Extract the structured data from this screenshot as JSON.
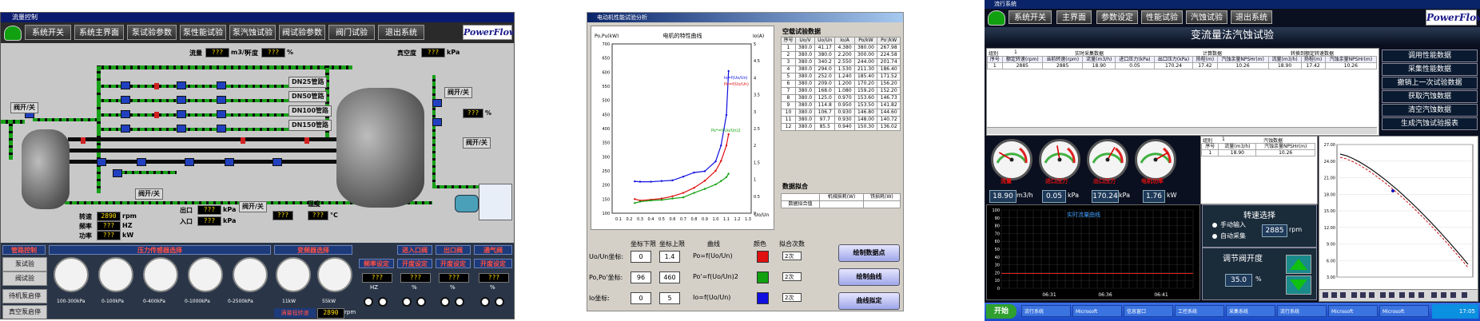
{
  "p1": {
    "window_title": "流量控制",
    "menu": [
      "系统开关",
      "系统主界面",
      "泵试验参数",
      "泵性能试验",
      "泵汽蚀试验",
      "阀试验参数",
      "阀门试验",
      "退出系统"
    ],
    "brand": "PowerFlow",
    "flow_label": "流量",
    "flow_value": "???",
    "flow_unit": "m3/h",
    "opening_label": "开度",
    "opening_value": "???",
    "opening_unit": "%",
    "vacuum_label": "真空度",
    "vacuum_value": "???",
    "vacuum_unit": "kPa",
    "dn_labels": [
      "DN25管路",
      "DN50管路",
      "DN100管路",
      "DN150管路"
    ],
    "valve_switch": "阀开/关",
    "opening_small": "开度",
    "opening_small_value": "???",
    "opening_small_unit": "%",
    "speed_label": "转速",
    "speed_value": "2890",
    "speed_unit": "rpm",
    "freq_label": "频率",
    "freq_value": "???",
    "freq_unit": "HZ",
    "power_label": "功率",
    "power_value": "???",
    "power_unit": "kW",
    "outlet_label": "出口",
    "outlet_value": "???",
    "outlet_unit": "kPa",
    "inlet_label": "入口",
    "inlet_value": "???",
    "inlet_unit": "kPa",
    "temp_label": "温度",
    "temp_value": "???",
    "temp_unit": "°C",
    "controls": {
      "mgmt_title": "管路控制",
      "pressure_title": "压力传感器选择",
      "transmitter_title": "变频器选择",
      "inlet_valve": "进入口阀",
      "outlet_valve": "出口阀",
      "vent_valve": "通气阀",
      "pump_test": "泵试验",
      "valve_test": "阀试验",
      "standby": "待机泵启停",
      "vacuum_pump": "真空泵启停",
      "freq_set": "频率设定",
      "freq_set_value": "???",
      "freq_set_unit": "HZ",
      "opening_set": "开度设定",
      "opening_set_value": "???",
      "opening_set_unit": "%",
      "ranges": [
        "100-300kPa",
        "0-100kPa",
        "0-400kPa",
        "0-1000kPa",
        "0-2500kPa"
      ],
      "vfd_ranges": [
        "11kW",
        "55kW"
      ],
      "speed_input_label": "满量程转速",
      "speed_input_value": "2890",
      "speed_input_unit": "rpm"
    }
  },
  "p2": {
    "window_title": "电动机性能试验分析",
    "chart_title": "电机的特性曲线",
    "y_left_label": "Po,Pu(kW)",
    "y_right_label": "Io(A)",
    "x_label": "Uo/Un",
    "y_left_ticks": [
      "700",
      "650",
      "600",
      "550",
      "500",
      "450",
      "400",
      "350",
      "300",
      "250",
      "200",
      "150",
      "100"
    ],
    "y_right_ticks": [
      "5",
      "4.5",
      "4",
      "3.5",
      "3",
      "2.5",
      "2",
      "1.5",
      "1",
      "0.5",
      "0"
    ],
    "x_ticks": [
      "0.1",
      "0.2",
      "0.3",
      "0.4",
      "0.5",
      "0.6",
      "0.7",
      "0.8",
      "0.9",
      "1.0",
      "1.1",
      "1.2",
      "1.3"
    ],
    "curve_labels": [
      "Po=f(Uo/Un)",
      "Po*=f(Uo/Un)2",
      "Io=f(Uo/Un)"
    ],
    "data_title": "空载试验数据",
    "data_headers": [
      "序号",
      "Uo/V",
      "Uo/Un",
      "Io/A",
      "Po/kW",
      "Po'/kW"
    ],
    "data_rows": [
      [
        "1",
        "380.0",
        "41.17",
        "4.380",
        "380.00",
        "267.98"
      ],
      [
        "2",
        "380.0",
        "380.0",
        "2.200",
        "300.00",
        "224.58"
      ],
      [
        "3",
        "380.0",
        "340.2",
        "2.550",
        "244.00",
        "201.74"
      ],
      [
        "4",
        "380.0",
        "294.0",
        "1.530",
        "211.30",
        "186.40"
      ],
      [
        "5",
        "380.0",
        "252.0",
        "1.240",
        "185.40",
        "171.52"
      ],
      [
        "6",
        "380.0",
        "209.0",
        "1.200",
        "170.20",
        "156.20"
      ],
      [
        "7",
        "380.0",
        "168.0",
        "1.080",
        "159.20",
        "152.20"
      ],
      [
        "8",
        "380.0",
        "125.0",
        "0.970",
        "153.60",
        "146.73"
      ],
      [
        "9",
        "380.0",
        "114.8",
        "0.950",
        "153.50",
        "141.82"
      ],
      [
        "10",
        "380.0",
        "106.7",
        "0.930",
        "146.80",
        "144.60"
      ],
      [
        "11",
        "380.0",
        "97.7",
        "0.930",
        "148.00",
        "140.72"
      ],
      [
        "12",
        "380.0",
        "85.5",
        "0.940",
        "150.30",
        "136.02"
      ]
    ],
    "result_title": "数据拟合",
    "result_headers": [
      "",
      "机械损耗(W)",
      "铁损耗(W)"
    ],
    "result_row_label": "数据拟合值",
    "param_headers": [
      "坐标下限",
      "坐标上限",
      "曲线",
      "颜色",
      "拟合次数"
    ],
    "params": [
      {
        "label": "Uo/Un坐标:",
        "lo": "0",
        "hi": "1.4",
        "curve": "Po=f(Uo/Un)",
        "color": "#e01010",
        "order": "2次"
      },
      {
        "label": "Po,Po'坐标:",
        "lo": "96",
        "hi": "460",
        "curve": "Po'=f(Uo/Un)2",
        "color": "#10a010",
        "order": "2次"
      },
      {
        "label": "Io坐标:",
        "lo": "0",
        "hi": "5",
        "curve": "Io=f(Uo/Un)",
        "color": "#1010e0",
        "order": "2次"
      }
    ],
    "buttons": [
      "绘制数据点",
      "绘制曲线",
      "曲线拟定"
    ]
  },
  "p3": {
    "window_title": "流行系统",
    "menu": [
      "系统开关",
      "主界面",
      "参数设定",
      "性能试验",
      "汽蚀试验",
      "退出系统"
    ],
    "brand": "PowerFlow",
    "page_title": "变流量法汽蚀试验",
    "table_groups": [
      "组别",
      "实时采集数据",
      "计算数据",
      "转换到额定转速数据"
    ],
    "table_headers": [
      "序号",
      "额定转速(rpm)",
      "当前转速(rpm)",
      "流量(m3/h)",
      "进口压力(kPa)",
      "出口压力(kPa)",
      "扬程(m)",
      "汽蚀余量NPSHr(m)",
      "流量(m3/h)",
      "扬程(m)",
      "汽蚀余量NPSHr(m)"
    ],
    "table_row": [
      "1",
      "2885",
      "2885",
      "18.90",
      "0.05",
      "170.24",
      "17.42",
      "10.26",
      "18.90",
      "17.42",
      "10.26"
    ],
    "group_no": "1",
    "right_buttons": [
      "调用性能数据",
      "采集性能数据",
      "撤销上一次试验数据",
      "获取汽蚀数据",
      "清空汽蚀数据",
      "生成汽蚀试验报表"
    ],
    "gauges": [
      "流量",
      "进口压力",
      "出口压力",
      "电机功率"
    ],
    "gauge_values": [
      {
        "v": "18.90",
        "u": "m3/h"
      },
      {
        "v": "0.05",
        "u": "kPa"
      },
      {
        "v": "170.24",
        "u": "kPa"
      },
      {
        "v": "1.76",
        "u": "kW"
      }
    ],
    "small_table_title": "汽蚀数据",
    "small_table_headers": [
      "序号",
      "流量(m3/h)",
      "汽蚀余量NPSHr(m)"
    ],
    "small_table_row": [
      "1",
      "18.90",
      "10.26"
    ],
    "small_group": "组别",
    "realtime_title": "实时流量曲线",
    "realtime_y_ticks": [
      "100",
      "90",
      "80",
      "70",
      "60",
      "50",
      "40",
      "30",
      "20",
      "10",
      "0"
    ],
    "realtime_x_ticks": [
      "06:31",
      "06:36",
      "06:41"
    ],
    "speed_title": "转速选择",
    "speed_manual": "手动输入",
    "speed_auto": "自动采集",
    "speed_value": "2885",
    "speed_unit": "rpm",
    "valve_title": "调节阀开度",
    "valve_value": "35.0",
    "valve_unit": "%",
    "npsh_y_ticks": [
      "27.00",
      "24.00",
      "21.00",
      "18.00",
      "15.00",
      "12.00",
      "9.00",
      "6.00",
      "3.00"
    ],
    "taskbar_start": "开始",
    "taskbar_items": [
      "流行系统",
      "Microsoft",
      "信息窗口",
      "工控系统",
      "采集系统",
      "流行系统",
      "Microsoft",
      "Microsoft"
    ],
    "clock": "17:05"
  }
}
